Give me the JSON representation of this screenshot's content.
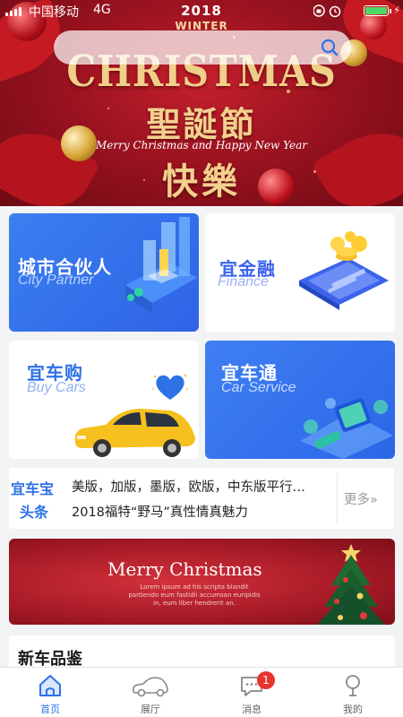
{
  "status_bar": {
    "carrier": "中国移动",
    "network": "4G",
    "battery_level": 1.0,
    "battery_color": "#4cd964"
  },
  "hero_banner": {
    "year": "2018",
    "season": "WINTER",
    "title": "CHRISTMAS",
    "cn_line1": "聖誕節",
    "script": "Merry Christmas and Happy New Year",
    "cn_line2": "快樂"
  },
  "search": {
    "icon": "search-icon",
    "accent": "#2e72e6"
  },
  "cards": [
    {
      "title": "城市合伙人",
      "subtitle": "City Partner"
    },
    {
      "title": "宜金融",
      "subtitle": "Finance"
    },
    {
      "title": "宜车购",
      "subtitle": "Buy Cars"
    },
    {
      "title": "宜车通",
      "subtitle": "Car Service"
    }
  ],
  "news": {
    "logo_line1": "宜车宝",
    "logo_line2": "头条",
    "items": [
      "美版，加版，墨版，欧版，中东版平行…",
      "2018福特“野马”真性情真魅力"
    ],
    "more_label": "更多"
  },
  "promo_banner": {
    "title": "Merry Christmas",
    "subtitle": "Lorem ipsum ad his scripta blandit partiendo eum fastidii accumsan euripidis in, eum liber hendrerit an."
  },
  "section": {
    "title": "新车品鉴"
  },
  "tabbar": {
    "tabs": [
      {
        "label": "首页",
        "icon": "home-icon",
        "active": true
      },
      {
        "label": "展厅",
        "icon": "car-icon",
        "active": false
      },
      {
        "label": "消息",
        "icon": "message-icon",
        "active": false,
        "badge": "1"
      },
      {
        "label": "我的",
        "icon": "user-icon",
        "active": false
      }
    ],
    "active_color": "#2e72e6",
    "badge_color": "#e8342f"
  }
}
